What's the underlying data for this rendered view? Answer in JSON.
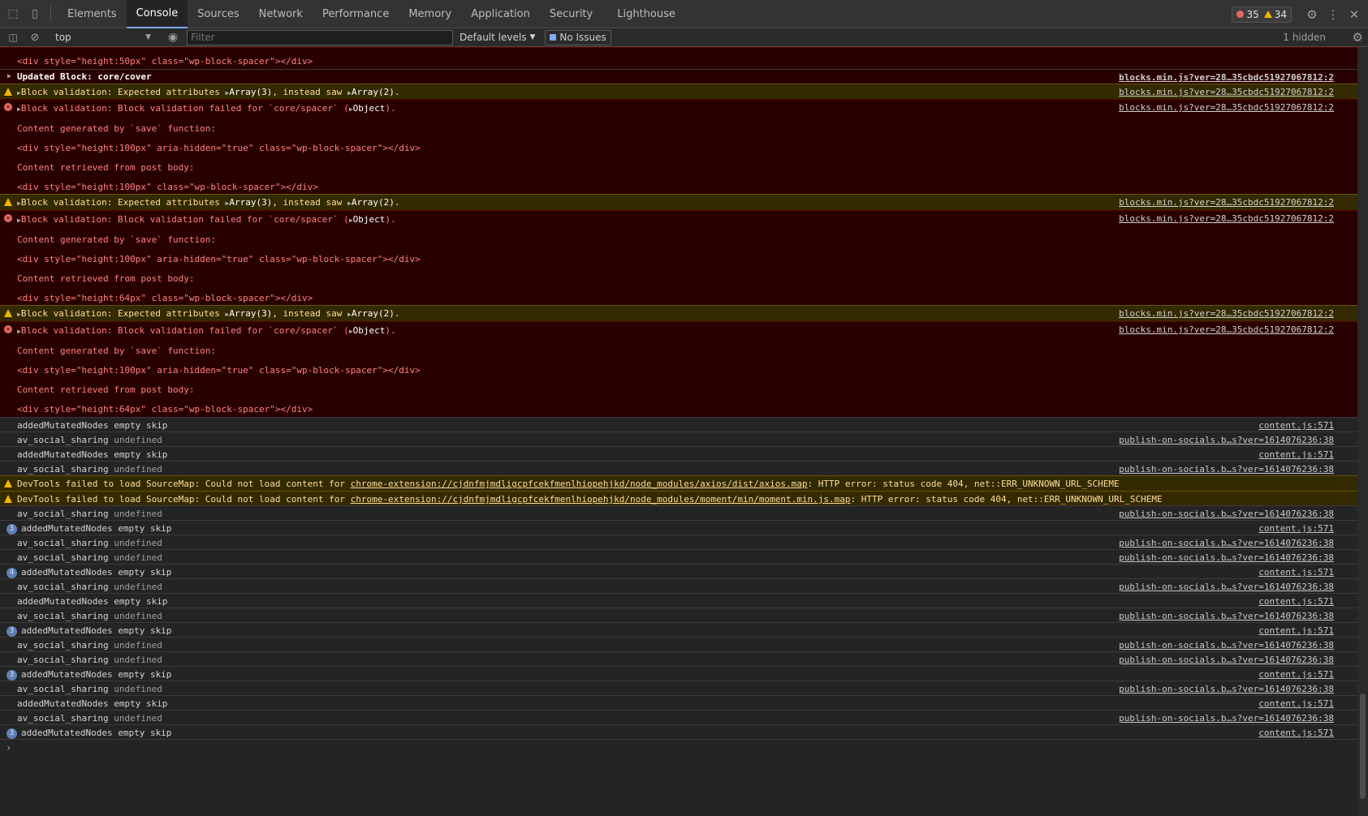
{
  "tabs": [
    {
      "label": "Elements"
    },
    {
      "label": "Console"
    },
    {
      "label": "Sources"
    },
    {
      "label": "Network"
    },
    {
      "label": "Performance"
    },
    {
      "label": "Memory"
    },
    {
      "label": "Application"
    },
    {
      "label": "Security"
    },
    {
      "label": "Lighthouse"
    }
  ],
  "active_tab": "Console",
  "counts": {
    "errors": "35",
    "warnings": "34"
  },
  "toolbar": {
    "context": "top",
    "filter_placeholder": "Filter",
    "levels": "Default levels",
    "issues": "No Issues",
    "hidden": "1 hidden"
  },
  "messages": {
    "m0": {
      "text": "<div style=\"height:50px\" class=\"wp-block-spacer\"></div>"
    },
    "m1": {
      "text": "Updated Block: core/cover",
      "source": "blocks.min.js?ver=28…35cbdc51927067812:2"
    },
    "m2": {
      "pre": "Block validation: Expected attributes ",
      "arr1": "Array(3)",
      "mid": ", instead saw ",
      "arr2": "Array(2)",
      "post": ".",
      "source": "blocks.min.js?ver=28…35cbdc51927067812:2"
    },
    "m3": {
      "pre": "Block validation: Block validation failed for `core/spacer` (",
      "obj": "Object",
      "post": ").",
      "l2": "Content generated by `save` function:",
      "l3": "<div style=\"height:100px\" aria-hidden=\"true\" class=\"wp-block-spacer\"></div>",
      "l4": "Content retrieved from post body:",
      "l5": "<div style=\"height:100px\" class=\"wp-block-spacer\"></div>",
      "source": "blocks.min.js?ver=28…35cbdc51927067812:2"
    },
    "m4": {
      "pre": "Block validation: Expected attributes ",
      "arr1": "Array(3)",
      "mid": ", instead saw ",
      "arr2": "Array(2)",
      "post": ".",
      "source": "blocks.min.js?ver=28…35cbdc51927067812:2"
    },
    "m5": {
      "pre": "Block validation: Block validation failed for `core/spacer` (",
      "obj": "Object",
      "post": ").",
      "l2": "Content generated by `save` function:",
      "l3": "<div style=\"height:100px\" aria-hidden=\"true\" class=\"wp-block-spacer\"></div>",
      "l4": "Content retrieved from post body:",
      "l5": "<div style=\"height:64px\" class=\"wp-block-spacer\"></div>",
      "source": "blocks.min.js?ver=28…35cbdc51927067812:2"
    },
    "m6": {
      "pre": "Block validation: Expected attributes ",
      "arr1": "Array(3)",
      "mid": ", instead saw ",
      "arr2": "Array(2)",
      "post": ".",
      "source": "blocks.min.js?ver=28…35cbdc51927067812:2"
    },
    "m7": {
      "pre": "Block validation: Block validation failed for `core/spacer` (",
      "obj": "Object",
      "post": ").",
      "l2": "Content generated by `save` function:",
      "l3": "<div style=\"height:100px\" aria-hidden=\"true\" class=\"wp-block-spacer\"></div>",
      "l4": "Content retrieved from post body:",
      "l5": "<div style=\"height:64px\" class=\"wp-block-spacer\"></div>",
      "source": "blocks.min.js?ver=28…35cbdc51927067812:2"
    },
    "m8": {
      "text": "addedMutatedNodes empty skip",
      "source": "content.js:571"
    },
    "m9": {
      "key": "av_social_sharing",
      "val": " undefined",
      "source": "publish-on-socials.b…s?ver=1614076236:38"
    },
    "m10": {
      "text": "addedMutatedNodes empty skip",
      "source": "content.js:571"
    },
    "m11": {
      "key": "av_social_sharing",
      "val": " undefined",
      "source": "publish-on-socials.b…s?ver=1614076236:38"
    },
    "m12": {
      "pre": "DevTools failed to load SourceMap: Could not load content for ",
      "link": "chrome-extension://cjdnfmjmdligcpfcekfmenlhiopehjkd/node_modules/axios/dist/axios.map",
      "post": ": HTTP error: status code 404, net::ERR_UNKNOWN_URL_SCHEME"
    },
    "m13": {
      "pre": "DevTools failed to load SourceMap: Could not load content for ",
      "link": "chrome-extension://cjdnfmjmdligcpfcekfmenlhiopehjkd/node_modules/moment/min/moment.min.js.map",
      "post": ": HTTP error: status code 404, net::ERR_UNKNOWN_URL_SCHEME"
    },
    "m14": {
      "key": "av_social_sharing",
      "val": " undefined",
      "source": "publish-on-socials.b…s?ver=1614076236:38"
    },
    "m15": {
      "count": "3",
      "text": "addedMutatedNodes empty skip",
      "source": "content.js:571"
    },
    "m16": {
      "key": "av_social_sharing",
      "val": " undefined",
      "source": "publish-on-socials.b…s?ver=1614076236:38"
    },
    "m17": {
      "key": "av_social_sharing",
      "val": " undefined",
      "source": "publish-on-socials.b…s?ver=1614076236:38"
    },
    "m18": {
      "count": "4",
      "text": "addedMutatedNodes empty skip",
      "source": "content.js:571"
    },
    "m19": {
      "key": "av_social_sharing",
      "val": " undefined",
      "source": "publish-on-socials.b…s?ver=1614076236:38"
    },
    "m20": {
      "text": "addedMutatedNodes empty skip",
      "source": "content.js:571"
    },
    "m21": {
      "key": "av_social_sharing",
      "val": " undefined",
      "source": "publish-on-socials.b…s?ver=1614076236:38"
    },
    "m22": {
      "count": "3",
      "text": "addedMutatedNodes empty skip",
      "source": "content.js:571"
    },
    "m23": {
      "key": "av_social_sharing",
      "val": " undefined",
      "source": "publish-on-socials.b…s?ver=1614076236:38"
    },
    "m24": {
      "key": "av_social_sharing",
      "val": " undefined",
      "source": "publish-on-socials.b…s?ver=1614076236:38"
    },
    "m25": {
      "count": "3",
      "text": "addedMutatedNodes empty skip",
      "source": "content.js:571"
    },
    "m26": {
      "key": "av_social_sharing",
      "val": " undefined",
      "source": "publish-on-socials.b…s?ver=1614076236:38"
    },
    "m27": {
      "text": "addedMutatedNodes empty skip",
      "source": "content.js:571"
    },
    "m28": {
      "key": "av_social_sharing",
      "val": " undefined",
      "source": "publish-on-socials.b…s?ver=1614076236:38"
    },
    "m29": {
      "count": "3",
      "text": "addedMutatedNodes empty skip",
      "source": "content.js:571"
    }
  },
  "prompt": "›"
}
